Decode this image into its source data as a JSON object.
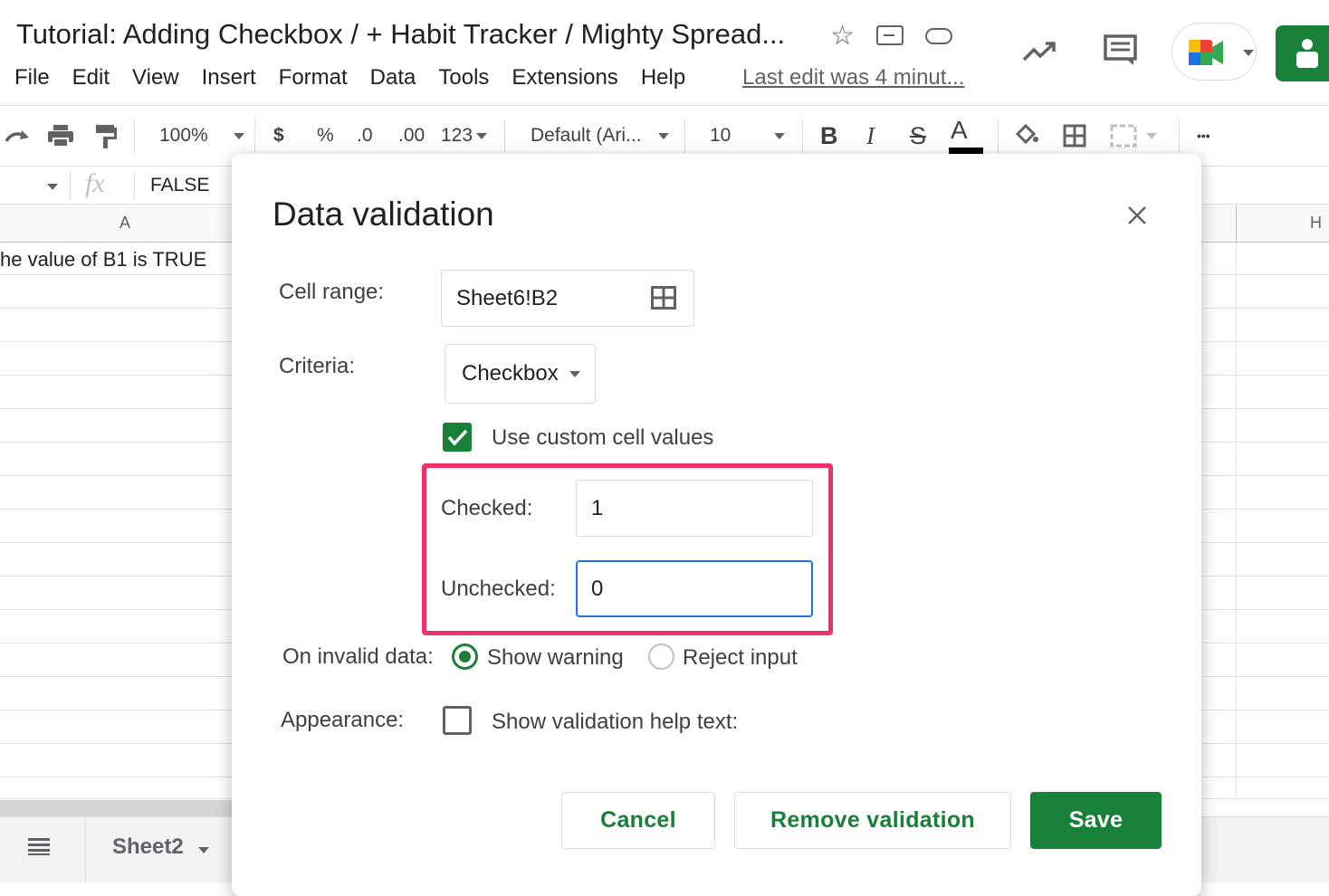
{
  "doc": {
    "title": "Tutorial: Adding Checkbox / + Habit Tracker / Mighty Spread...",
    "last_edit": "Last edit was 4 minut..."
  },
  "menu": [
    "File",
    "Edit",
    "View",
    "Insert",
    "Format",
    "Data",
    "Tools",
    "Extensions",
    "Help"
  ],
  "toolbar": {
    "zoom": "100%",
    "currency": "$",
    "percent": "%",
    "dec_decrease": ".0",
    "dec_increase": ".00",
    "more_formats": "123",
    "font": "Default (Ari...",
    "font_size": "10",
    "bold": "B",
    "italic": "I",
    "strike": "S",
    "text_color": "A",
    "more": "•••"
  },
  "formula": {
    "fx": "fx",
    "value": "FALSE"
  },
  "grid": {
    "col_a": "A",
    "col_h": "H",
    "a1": "he value of B1 is TRUE"
  },
  "sheet_tab": {
    "name": "Sheet2"
  },
  "dialog": {
    "title": "Data validation",
    "cell_range_label": "Cell range:",
    "cell_range_value": "Sheet6!B2",
    "criteria_label": "Criteria:",
    "criteria_value": "Checkbox",
    "custom_values_label": "Use custom cell values",
    "custom_values_checked": true,
    "checked_label": "Checked:",
    "checked_value": "1",
    "unchecked_label": "Unchecked:",
    "unchecked_value": "0",
    "invalid_label": "On invalid data:",
    "invalid_options": [
      "Show warning",
      "Reject input"
    ],
    "invalid_selected": "Show warning",
    "appearance_label": "Appearance:",
    "help_text_label": "Show validation help text:",
    "help_text_checked": false,
    "cancel": "Cancel",
    "remove": "Remove validation",
    "save": "Save"
  },
  "colors": {
    "accent_green": "#188038",
    "highlight": "#f0306a",
    "focus_blue": "#1a73e8"
  }
}
